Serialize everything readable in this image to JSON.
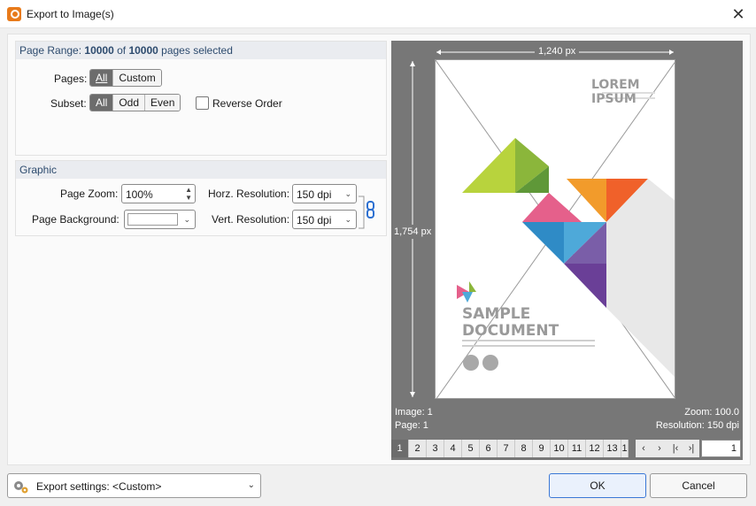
{
  "window": {
    "title": "Export to Image(s)"
  },
  "page_range": {
    "prefix": "Page Range: ",
    "selected": "10000",
    "of": " of ",
    "total": "10000",
    "suffix": " pages selected"
  },
  "pages": {
    "label": "Pages:",
    "options": [
      "All",
      "Custom"
    ],
    "selected": "All"
  },
  "subset": {
    "label": "Subset:",
    "options": [
      "All",
      "Odd",
      "Even"
    ],
    "selected": "All"
  },
  "reverse_order": {
    "label": "Reverse Order",
    "checked": false
  },
  "graphic": {
    "header": "Graphic",
    "page_zoom_label": "Page Zoom:",
    "page_zoom_value": "100%",
    "page_background_label": "Page Background:",
    "horz_resolution_label": "Horz. Resolution:",
    "horz_resolution_value": "150 dpi",
    "vert_resolution_label": "Vert. Resolution:",
    "vert_resolution_value": "150 dpi"
  },
  "preview": {
    "width_label": "1,240 px",
    "height_label": "1,754 px",
    "image_label": "Image: 1",
    "page_label": "Page: 1",
    "zoom_label": "Zoom: 100.0",
    "resolution_label": "Resolution: 150 dpi",
    "document": {
      "brand": "LOREM IPSUM",
      "title_line1": "SAMPLE",
      "title_line2": "DOCUMENT"
    }
  },
  "pagination": {
    "pages": [
      "1",
      "2",
      "3",
      "4",
      "5",
      "6",
      "7",
      "8",
      "9",
      "10",
      "11",
      "12",
      "13",
      "1"
    ],
    "current": "1",
    "nav": [
      "‹",
      "›",
      "|‹",
      "›|"
    ],
    "page_input": "1"
  },
  "footer": {
    "export_settings": "Export settings: <Custom>",
    "ok": "OK",
    "cancel": "Cancel"
  },
  "colors": {
    "accent": "#3b78d6",
    "segment_active": "#6c6c6c",
    "preview_bg": "#777777",
    "group_header_text": "#2d4b6e"
  }
}
